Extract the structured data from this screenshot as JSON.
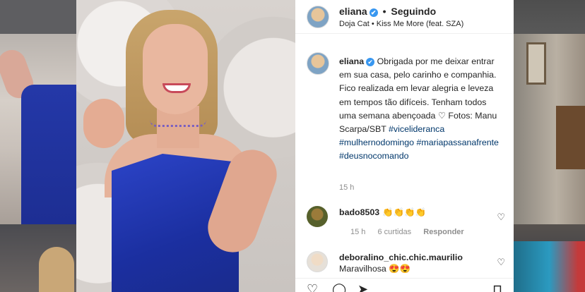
{
  "header": {
    "username": "eliana",
    "separator": "•",
    "follow_status": "Seguindo",
    "music": "Doja Cat • Kiss Me More (feat. SZA)"
  },
  "caption": {
    "username": "eliana",
    "text_intro": "Obrigada por me deixar entrar em sua casa, pelo carinho e companhia. Fico realizada em levar alegria e leveza em tempos tão difíceis. Tenham todos uma semana abençoada",
    "heart": "♡",
    "text_photos": "Fotos: Manu Scarpa/SBT",
    "hashtags": [
      "#vicelideranca",
      "#mulhernodomingo",
      "#mariapassanafrente",
      "#deusnocomando"
    ],
    "time": "15 h"
  },
  "comments": [
    {
      "username": "bado8503",
      "message": "👏👏👏👏",
      "time": "15 h",
      "likes": "6 curtidas",
      "reply": "Responder"
    },
    {
      "username": "deboralino_chic.chic.maurilio",
      "message": "Maravilhosa 😍😍"
    }
  ],
  "icons": {
    "verified": "✔",
    "like": "♡",
    "comment": "◯",
    "share": "➤",
    "save": "⊓",
    "comment_heart": "♡"
  },
  "colors": {
    "verified": "#3897f0",
    "hashtag": "#00376b",
    "muted": "#8e8e8e",
    "dress": "#2c44c8"
  }
}
